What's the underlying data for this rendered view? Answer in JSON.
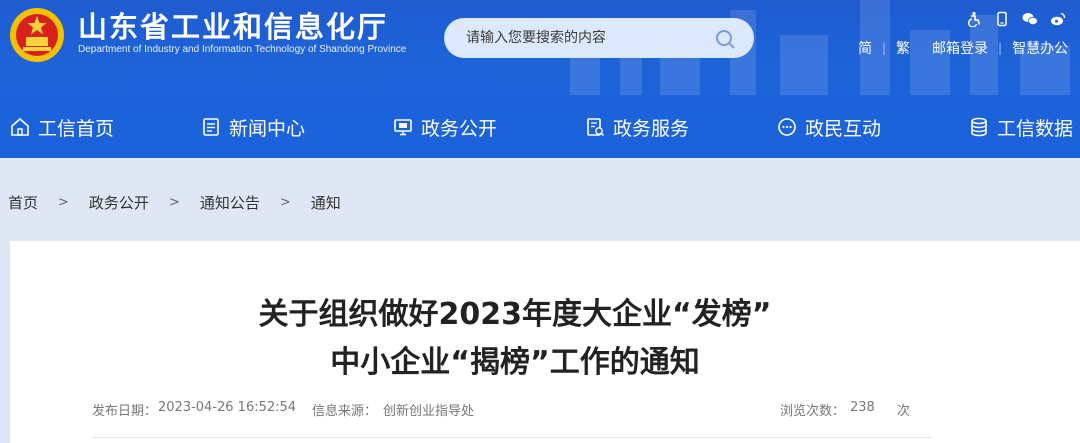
{
  "header": {
    "title": "山东省工业和信息化厅",
    "subtitle": "Department of Industry and Information Technology of Shandong Province",
    "search_placeholder": "请输入您要搜索的内容",
    "util_links": {
      "simplified": "简",
      "traditional": "繁",
      "mail_login": "邮箱登录",
      "smart_office": "智慧办公"
    },
    "colors": {
      "primary": "#1e63d8",
      "search_bg": "#dce8fb"
    },
    "icons": [
      "accessibility-icon",
      "mobile-icon",
      "wechat-icon",
      "weibo-icon"
    ]
  },
  "nav": {
    "items": [
      {
        "label": "工信首页",
        "icon": "home-icon"
      },
      {
        "label": "新闻中心",
        "icon": "news-icon"
      },
      {
        "label": "政务公开",
        "icon": "monitor-icon"
      },
      {
        "label": "政务服务",
        "icon": "service-icon"
      },
      {
        "label": "政民互动",
        "icon": "chat-icon"
      },
      {
        "label": "工信数据",
        "icon": "database-icon"
      }
    ]
  },
  "breadcrumb": {
    "items": [
      "首页",
      "政务公开",
      "通知公告",
      "通知"
    ],
    "separator": ">"
  },
  "article": {
    "title_line1": "关于组织做好2023年度大企业“发榜”",
    "title_line2": "中小企业“揭榜”工作的通知",
    "publish_label": "发布日期：",
    "publish_date": "2023-04-26 16:52:54",
    "source_label": "信息来源：",
    "source": "创新创业指导处",
    "views_label": "浏览次数：",
    "views": "238",
    "views_unit": "次"
  }
}
